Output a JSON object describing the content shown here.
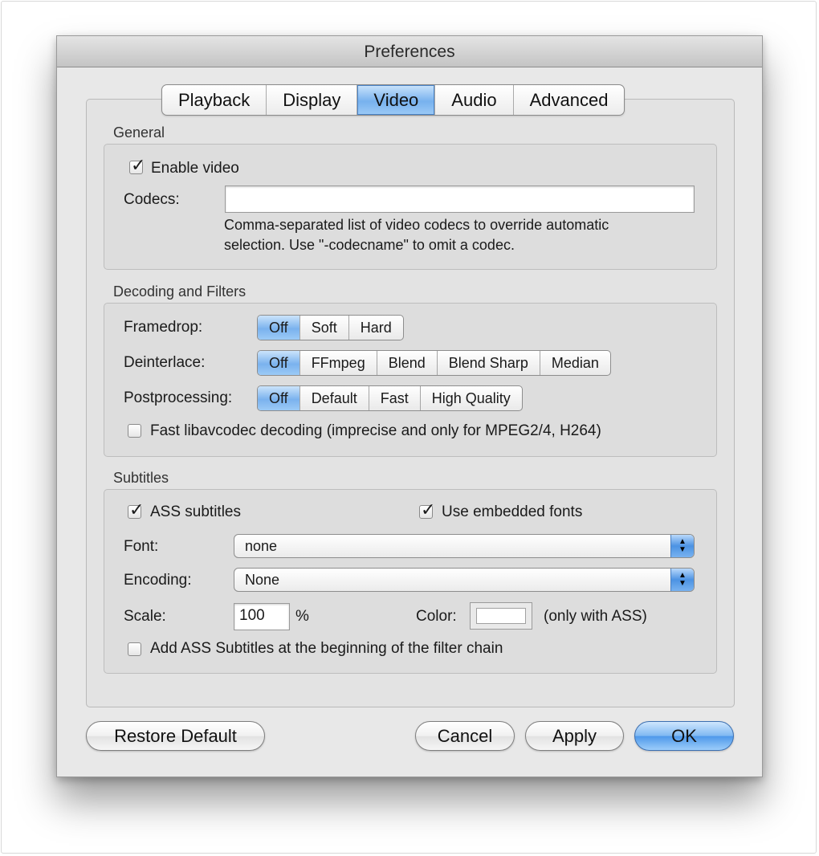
{
  "window": {
    "title": "Preferences"
  },
  "tabs": [
    {
      "label": "Playback",
      "selected": false
    },
    {
      "label": "Display",
      "selected": false
    },
    {
      "label": "Video",
      "selected": true
    },
    {
      "label": "Audio",
      "selected": false
    },
    {
      "label": "Advanced",
      "selected": false
    }
  ],
  "general": {
    "title": "General",
    "enable_video": {
      "label": "Enable video",
      "checked": true
    },
    "codecs": {
      "label": "Codecs:",
      "value": "",
      "help_line1": "Comma-separated list of video codecs to override automatic",
      "help_line2": "selection. Use \"-codecname\" to omit a codec."
    }
  },
  "decoding": {
    "title": "Decoding and Filters",
    "framedrop": {
      "label": "Framedrop:",
      "options": [
        "Off",
        "Soft",
        "Hard"
      ],
      "selected": "Off"
    },
    "deinterlace": {
      "label": "Deinterlace:",
      "options": [
        "Off",
        "FFmpeg",
        "Blend",
        "Blend Sharp",
        "Median"
      ],
      "selected": "Off"
    },
    "postprocessing": {
      "label": "Postprocessing:",
      "options": [
        "Off",
        "Default",
        "Fast",
        "High Quality"
      ],
      "selected": "Off"
    },
    "fast_decoding": {
      "label": "Fast libavcodec decoding (imprecise and only for MPEG2/4, H264)",
      "checked": false
    }
  },
  "subtitles": {
    "title": "Subtitles",
    "ass_subtitles": {
      "label": "ASS subtitles",
      "checked": true
    },
    "embedded_fonts": {
      "label": "Use embedded fonts",
      "checked": true
    },
    "font": {
      "label": "Font:",
      "value": "none"
    },
    "encoding": {
      "label": "Encoding:",
      "value": "None"
    },
    "scale": {
      "label": "Scale:",
      "value": "100",
      "unit": "%"
    },
    "color": {
      "label": "Color:",
      "value": "#ffffff",
      "note": "(only with ASS)"
    },
    "filter_chain": {
      "label": "Add ASS Subtitles at the beginning of the filter chain",
      "checked": false
    }
  },
  "buttons": {
    "restore": "Restore Default",
    "cancel": "Cancel",
    "apply": "Apply",
    "ok": "OK"
  }
}
